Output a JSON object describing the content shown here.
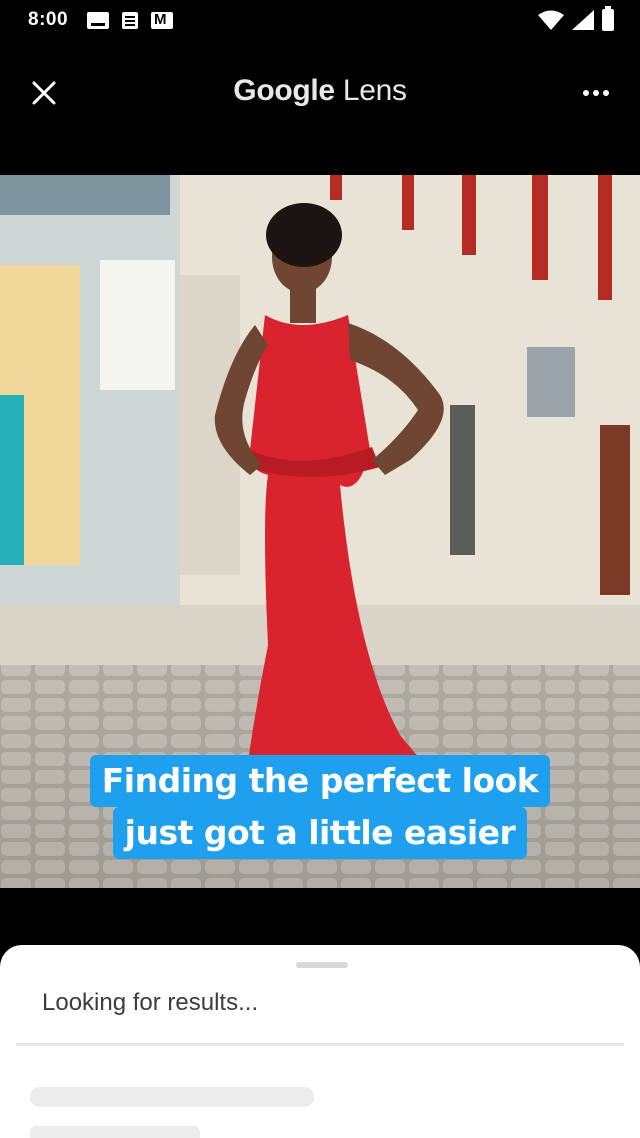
{
  "status_bar": {
    "time": "8:00",
    "notification_icons": [
      "message-icon",
      "document-icon",
      "gmail-icon"
    ],
    "system_icons": [
      "wifi-icon",
      "signal-icon",
      "battery-icon"
    ]
  },
  "app_bar": {
    "title_google": "Google",
    "title_lens": "Lens",
    "close_icon": "close-icon",
    "more_icon": "more-options-icon"
  },
  "photo": {
    "subject": "woman in red peplum mermaid dress on cobblestone street",
    "dress_color": "#d9232e"
  },
  "caption": {
    "line1": "Finding the perfect look",
    "line2": "just got a little easier",
    "background": "#1ea0ee"
  },
  "results_sheet": {
    "status": "Looking for results..."
  }
}
